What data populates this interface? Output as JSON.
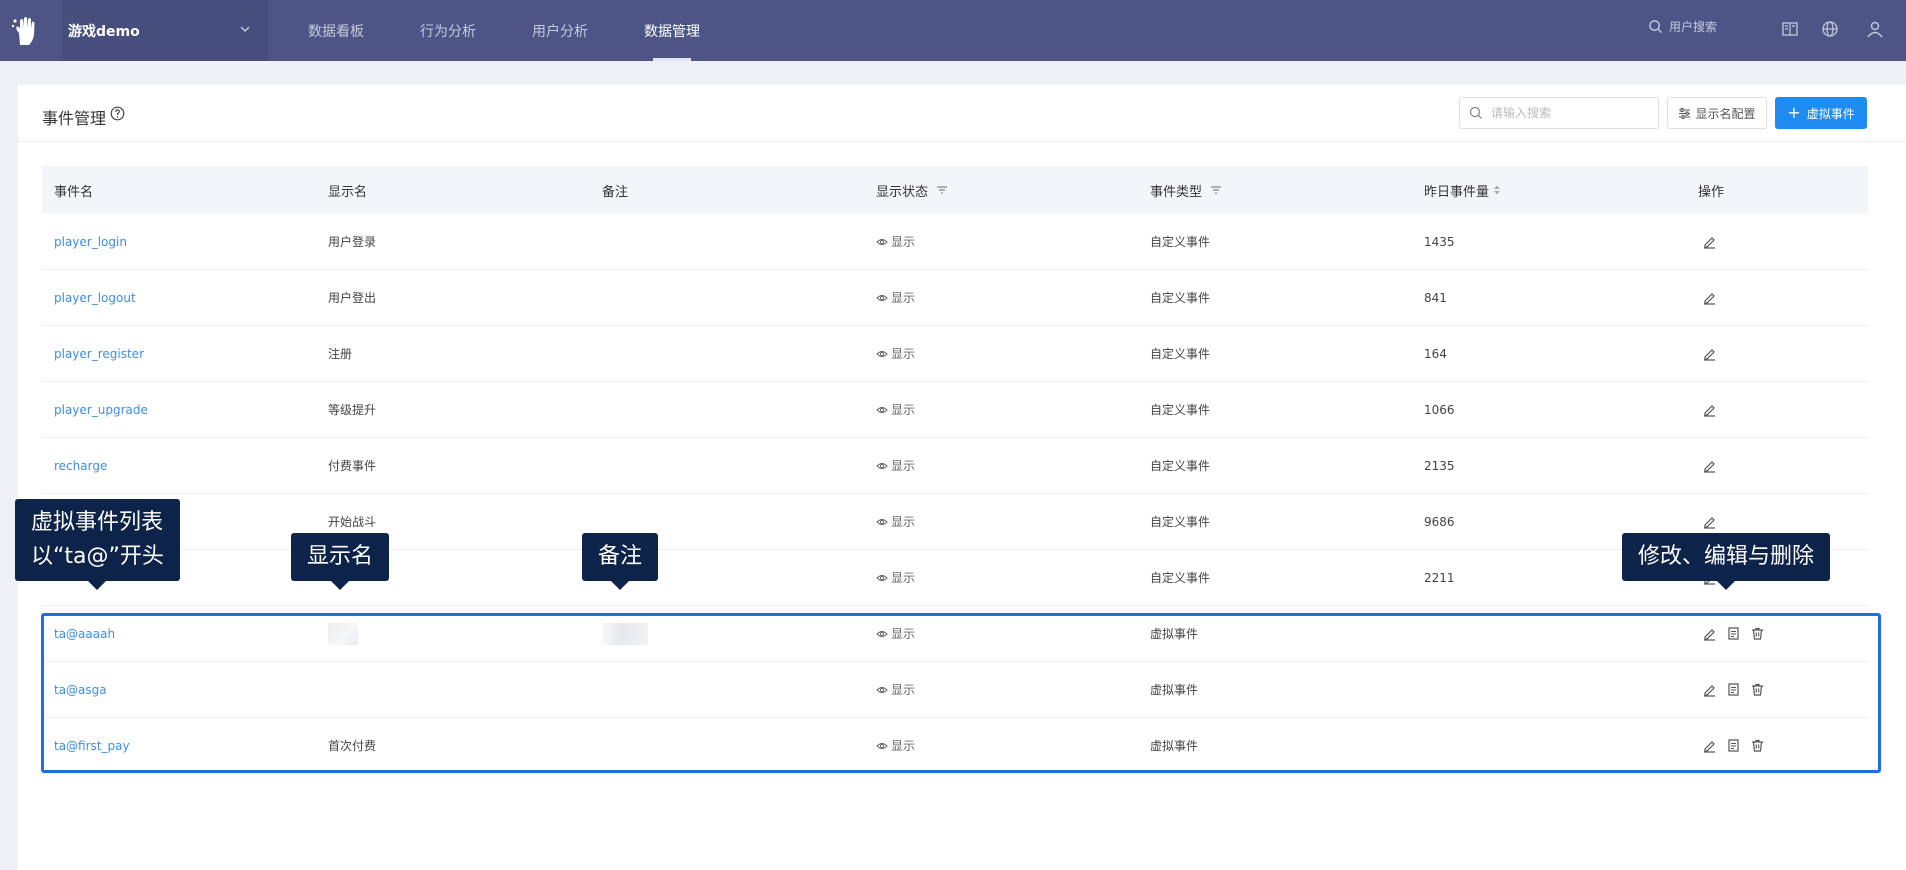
{
  "topbar": {
    "project_name": "游戏demo",
    "nav": [
      "数据看板",
      "行为分析",
      "用户分析",
      "数据管理"
    ],
    "active_nav": "数据管理",
    "user_search_placeholder": "用户搜索"
  },
  "header": {
    "title": "事件管理",
    "search_placeholder": "请输入搜索",
    "config_label": "显示名配置",
    "add_label": "虚拟事件"
  },
  "table": {
    "columns": [
      "事件名",
      "显示名",
      "备注",
      "显示状态",
      "事件类型",
      "昨日事件量",
      "操作"
    ],
    "rows": [
      {
        "name": "player_login",
        "display": "用户登录",
        "note": "",
        "status": "显示",
        "type": "自定义事件",
        "count": "1435"
      },
      {
        "name": "player_logout",
        "display": "用户登出",
        "note": "",
        "status": "显示",
        "type": "自定义事件",
        "count": "841"
      },
      {
        "name": "player_register",
        "display": "注册",
        "note": "",
        "status": "显示",
        "type": "自定义事件",
        "count": "164"
      },
      {
        "name": "player_upgrade",
        "display": "等级提升",
        "note": "",
        "status": "显示",
        "type": "自定义事件",
        "count": "1066"
      },
      {
        "name": "recharge",
        "display": "付费事件",
        "note": "",
        "status": "显示",
        "type": "自定义事件",
        "count": "2135"
      },
      {
        "name": "",
        "display": "开始战斗",
        "note": "",
        "status": "显示",
        "type": "自定义事件",
        "count": "9686"
      },
      {
        "name": "",
        "display": "",
        "note": "",
        "status": "显示",
        "type": "自定义事件",
        "count": "2211"
      },
      {
        "name": "ta@aaaah",
        "display": "",
        "note": "",
        "status": "显示",
        "type": "虚拟事件",
        "count": ""
      },
      {
        "name": "ta@asga",
        "display": "",
        "note": "",
        "status": "显示",
        "type": "虚拟事件",
        "count": ""
      },
      {
        "name": "ta@first_pay",
        "display": "首次付费",
        "note": "",
        "status": "显示",
        "type": "虚拟事件",
        "count": ""
      }
    ]
  },
  "callouts": {
    "virtual_list_line1": "虚拟事件列表",
    "virtual_list_line2": "以“ta@”开头",
    "display_name": "显示名",
    "note": "备注",
    "actions": "修改、编辑与删除"
  },
  "colors": {
    "topbar": "#4c5585",
    "link": "#3d8fe0",
    "primary": "#1f8cf2",
    "callout": "#0d2349",
    "highlight": "#1d6fe0"
  }
}
